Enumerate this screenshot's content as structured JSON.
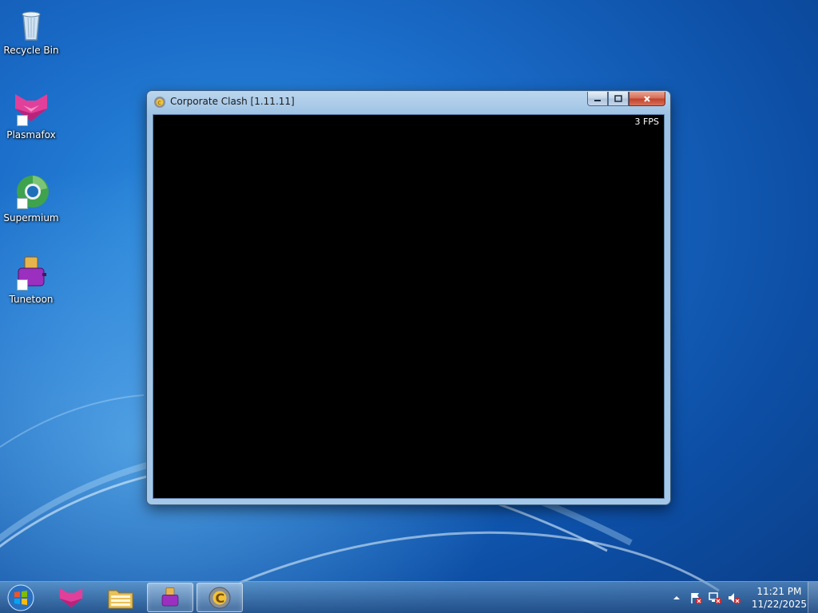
{
  "desktop_icons": [
    {
      "label": "Recycle Bin",
      "icon": "recycle-bin-icon"
    },
    {
      "label": "Plasmafox",
      "icon": "plasmafox-icon"
    },
    {
      "label": "Supermium",
      "icon": "supermium-icon"
    },
    {
      "label": "Tunetoon",
      "icon": "tunetoon-icon"
    }
  ],
  "window": {
    "title": "Corporate Clash [1.11.11]",
    "fps": "3 FPS",
    "icon": "corporate-clash-icon"
  },
  "taskbar": {
    "items": [
      {
        "icon": "plasmafox-icon",
        "state": "pinned"
      },
      {
        "icon": "file-explorer-icon",
        "state": "pinned"
      },
      {
        "icon": "tunetoon-icon",
        "state": "running"
      },
      {
        "icon": "corporate-clash-icon",
        "state": "running"
      }
    ],
    "clock": {
      "time": "11:21 PM",
      "date": "11/22/2025"
    }
  },
  "colors": {
    "accent": "#1a6cc8",
    "plasmafox": "#e0409a",
    "tunetoon": "#9b2fbf",
    "close_button": "#c1412a"
  }
}
